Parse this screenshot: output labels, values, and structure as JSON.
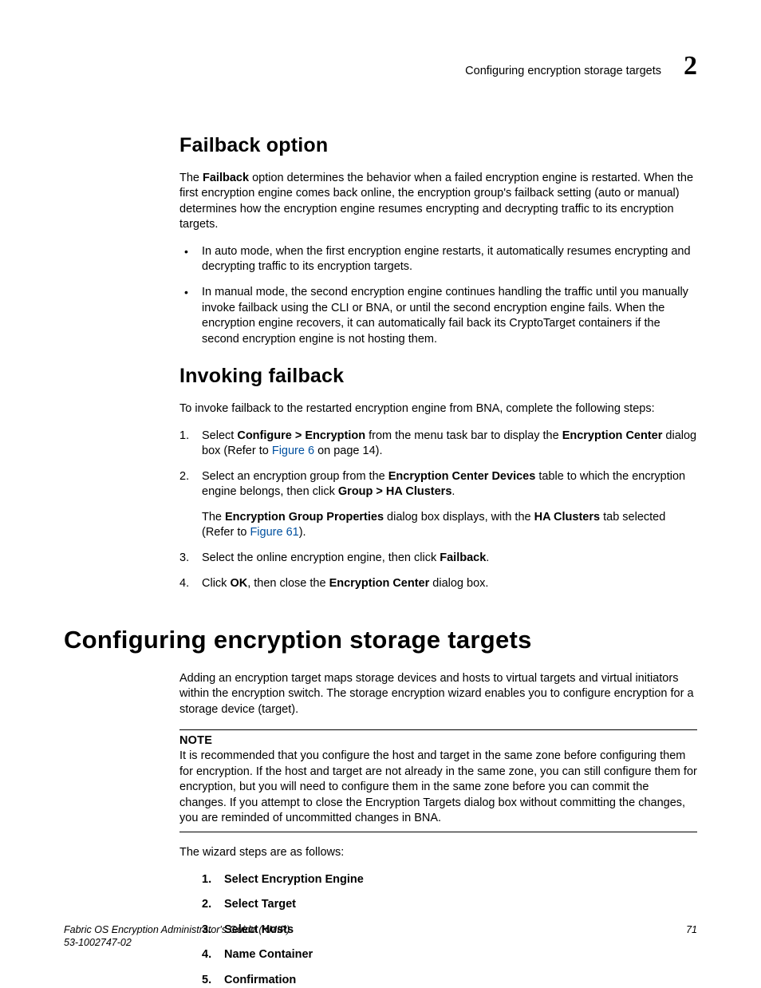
{
  "header": {
    "running_title": "Configuring encryption storage targets",
    "chapter_number": "2"
  },
  "section1": {
    "title": "Failback option",
    "intro_pre": "The ",
    "intro_bold": "Failback",
    "intro_post": " option determines the behavior when a failed encryption engine is restarted. When the first encryption engine comes back online, the encryption group's failback setting (auto or manual) determines how the encryption engine resumes encrypting and decrypting traffic to its encryption targets.",
    "bullet1": "In auto mode, when the first encryption engine restarts, it automatically resumes encrypting and decrypting traffic to its encryption targets.",
    "bullet2": "In manual mode, the second encryption engine continues handling the traffic until you manually invoke failback using the CLI or BNA, or until the second encryption engine fails. When the encryption engine recovers, it can automatically fail back its CryptoTarget containers if the second encryption engine is not hosting them."
  },
  "section2": {
    "title": "Invoking failback",
    "intro": "To invoke failback to the restarted encryption engine from BNA, complete the following steps:",
    "step1_a": "Select ",
    "step1_b": "Configure > Encryption",
    "step1_c": " from the menu task bar to display the ",
    "step1_d": "Encryption Center",
    "step1_e": " dialog box (Refer to ",
    "step1_link": "Figure 6",
    "step1_f": " on page 14).",
    "step2_a": "Select an encryption group from the ",
    "step2_b": "Encryption Center Devices",
    "step2_c": " table to which the encryption engine belongs, then click ",
    "step2_d": "Group > HA Clusters",
    "step2_e": ".",
    "step2p_a": "The ",
    "step2p_b": "Encryption Group Properties",
    "step2p_c": " dialog box displays, with the ",
    "step2p_d": "HA Clusters",
    "step2p_e": " tab selected (Refer to ",
    "step2p_link": "Figure 61",
    "step2p_f": ").",
    "step3_a": "Select the online encryption engine, then click ",
    "step3_b": "Failback",
    "step3_c": ".",
    "step4_a": "Click ",
    "step4_b": "OK",
    "step4_c": ", then close the ",
    "step4_d": "Encryption Center",
    "step4_e": " dialog box."
  },
  "section3": {
    "title": "Configuring encryption storage targets",
    "intro": "Adding an encryption target maps storage devices and hosts to virtual targets and virtual initiators within the encryption switch. The storage encryption wizard enables you to configure encryption for a storage device (target).",
    "note_title": "NOTE",
    "note_body": "It is recommended that you configure the host and target in the same zone before configuring them for encryption. If the host and target are not already in the same zone, you can still configure them for encryption, but you will need to configure them in the same zone before you can commit the changes. If you attempt to close the Encryption Targets dialog box without committing the changes, you are reminded of uncommitted changes in BNA.",
    "wizard_lead": "The wizard steps are as follows:",
    "wizard": [
      "Select Encryption Engine",
      "Select Target",
      "Select Hosts",
      "Name Container",
      "Confirmation"
    ]
  },
  "footer": {
    "book": "Fabric OS Encryption Administrator's Guide (KMIP)",
    "docnum": "53-1002747-02",
    "page": "71"
  }
}
